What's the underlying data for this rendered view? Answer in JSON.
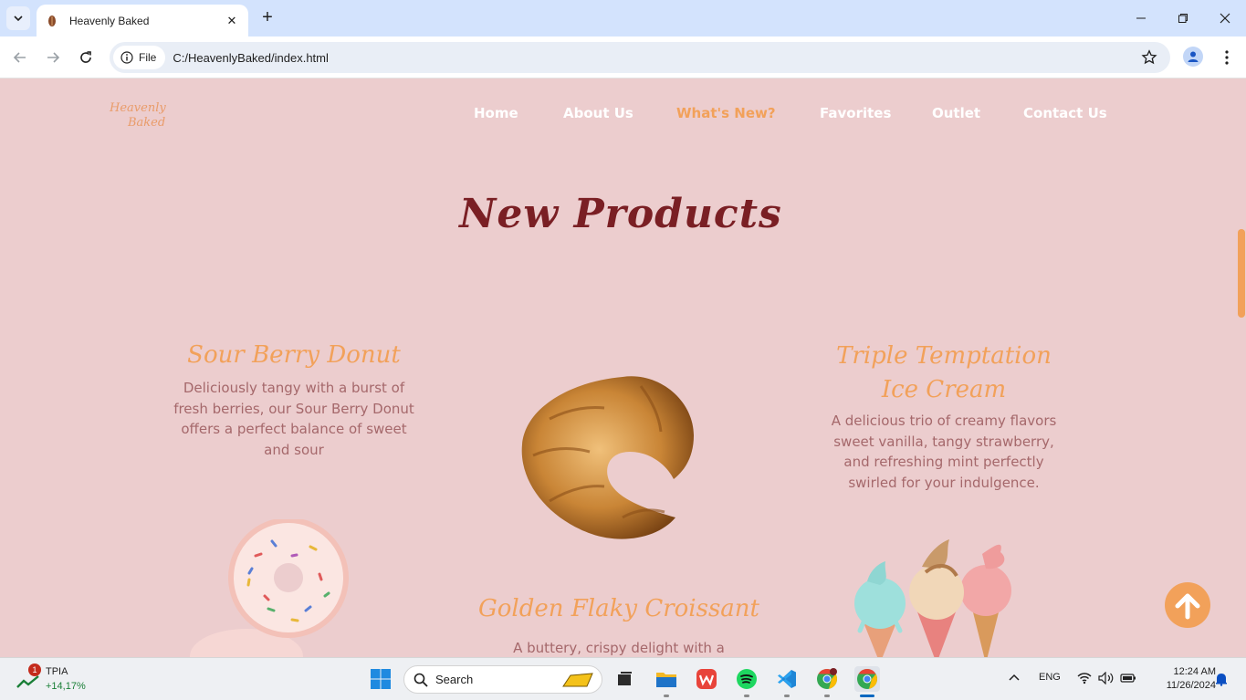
{
  "browser": {
    "tab_title": "Heavenly Baked",
    "chip_label": "File",
    "url": "C:/HeavenlyBaked/index.html"
  },
  "site": {
    "logo_line1": "Heavenly",
    "logo_line2": "Baked",
    "nav": [
      "Home",
      "About Us",
      "What's New?",
      "Favorites",
      "Outlet",
      "Contact Us"
    ],
    "active_nav": "What's New?",
    "section_title": "New Products",
    "products": [
      {
        "title": "Sour Berry Donut",
        "description": "Deliciously tangy with a burst of fresh berries, our Sour Berry Donut offers a perfect balance of sweet and sour"
      },
      {
        "title": "Golden Flaky Croissant",
        "description": "A buttery, crispy delight with a"
      },
      {
        "title": "Triple Temptation Ice Cream",
        "description": "A delicious trio of creamy flavors sweet vanilla, tangy strawberry, and refreshing mint perfectly swirled for your indulgence."
      }
    ]
  },
  "taskbar": {
    "stock_name": "TPIA",
    "stock_change": "+14,17%",
    "stock_badge": "1",
    "search_placeholder": "Search",
    "language": "ENG",
    "time": "12:24 AM",
    "date": "11/26/2024"
  },
  "colors": {
    "page_bg": "#eccdce",
    "accent": "#f2a15a",
    "title": "#7a1f24",
    "desc": "#a5686b"
  }
}
